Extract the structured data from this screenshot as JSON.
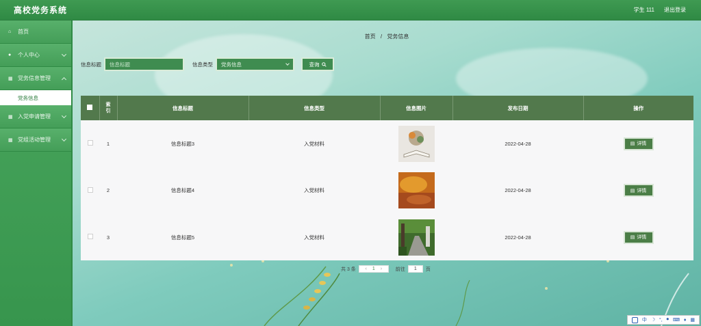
{
  "header": {
    "brand": "高校党务系统",
    "user": "学生 111",
    "logout": "退出登录"
  },
  "sidebar": {
    "items": [
      {
        "label": "首页",
        "icon": "home-icon",
        "glyph": "⌂"
      },
      {
        "label": "个人中心",
        "icon": "user-icon",
        "glyph": "●"
      },
      {
        "label": "党务信息管理",
        "icon": "grid-icon",
        "glyph": "▦"
      },
      {
        "label": "入党申请管理",
        "icon": "grid-icon",
        "glyph": "▦"
      },
      {
        "label": "党组活动管理",
        "icon": "grid-icon",
        "glyph": "▦"
      }
    ],
    "subitem": "党务信息"
  },
  "breadcrumb": {
    "home": "首页",
    "sep": "/",
    "current": "党务信息"
  },
  "search": {
    "title_label": "信息标题",
    "title_placeholder": "信息标题",
    "type_label": "信息类型",
    "type_value": "党务信息",
    "button": "查询"
  },
  "table": {
    "headers": [
      "索引",
      "信息标题",
      "信息类型",
      "信息图片",
      "发布日期",
      "操作"
    ],
    "rows": [
      {
        "index": "1",
        "title": "信息标题3",
        "type": "入党材料",
        "date": "2022-04-28",
        "action": "详情",
        "image": "book-image"
      },
      {
        "index": "2",
        "title": "信息标题4",
        "type": "入党材料",
        "date": "2022-04-28",
        "action": "详情",
        "image": "autumn-image"
      },
      {
        "index": "3",
        "title": "信息标题5",
        "type": "入党材料",
        "date": "2022-04-28",
        "action": "详情",
        "image": "garden-path-image"
      }
    ]
  },
  "pager": {
    "total": "共 3 条",
    "prev": "‹",
    "page": "1",
    "next": "›",
    "goto_label": "前往",
    "goto_value": "1",
    "page_unit": "页"
  },
  "tray": {
    "lang": "中",
    "moon": "☽",
    "dot": "°,"
  },
  "colors": {
    "header": "#2f8a44",
    "sidebar": "#449e58",
    "table_head": "#52794c",
    "button": "#3f8c50"
  }
}
